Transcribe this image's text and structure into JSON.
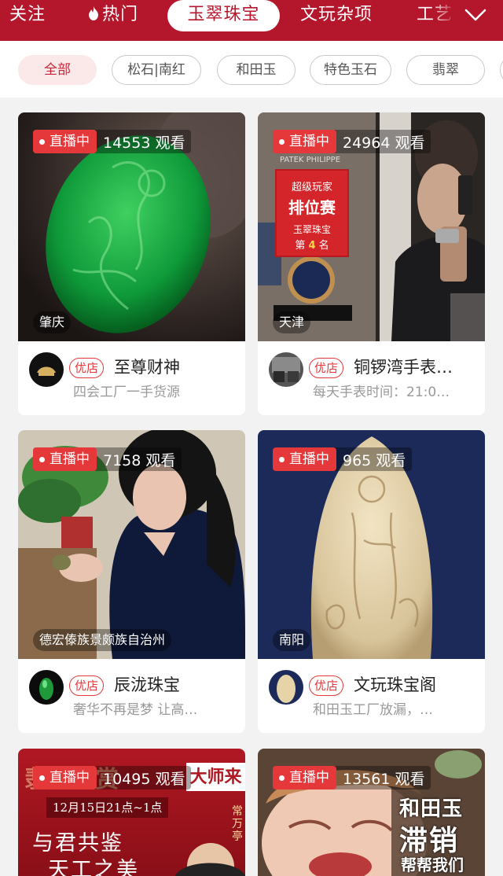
{
  "nav": {
    "items": [
      "关注",
      "热门",
      "玉翠珠宝",
      "文玩杂项",
      "工艺"
    ],
    "active_index": 2,
    "expand_icon": "chevron-down-icon",
    "hot_icon": "fire-icon",
    "colors": {
      "bar": "#b4172c",
      "active_text": "#b4172c"
    }
  },
  "filters": {
    "chips": [
      "全部",
      "松石|南红",
      "和田玉",
      "特色玉石",
      "翡翠"
    ],
    "active_index": 0
  },
  "live_label": "直播中",
  "shop_tag": "优店",
  "cards": [
    {
      "viewers": "14553 观看",
      "location": "肇庆",
      "shop": "至尊财神",
      "desc": "四会工厂一手货源"
    },
    {
      "viewers": "24964 观看",
      "location": "天津",
      "shop": "铜锣湾手表…",
      "desc": "每天手表时间：21:0…",
      "poster": {
        "brand": "PATEK PHILIPPE",
        "line1": "超级玩家",
        "line2": "排位赛",
        "line3": "玉翠珠宝",
        "rank_prefix": "第",
        "rank": "4",
        "rank_suffix": "名"
      }
    },
    {
      "viewers": "7158 观看",
      "location": "德宏傣族景颇族自治州",
      "shop": "辰泷珠宝",
      "desc": "奢华不再是梦 让高…"
    },
    {
      "viewers": "965 观看",
      "location": "南阳",
      "shop": "文玩珠宝阁",
      "desc": "和田玉工厂放漏，…"
    },
    {
      "viewers": "10495 观看",
      "poster": {
        "top": "翡翠大赏",
        "badge": "大师来",
        "date": "12月15日21点~1点",
        "line1": "与君共鉴",
        "line2": "天工之美",
        "side": "常万亭"
      }
    },
    {
      "viewers": "13561 观看",
      "poster": {
        "line1": "和田玉",
        "line2": "滞销",
        "line3": "帮帮我们"
      }
    }
  ]
}
